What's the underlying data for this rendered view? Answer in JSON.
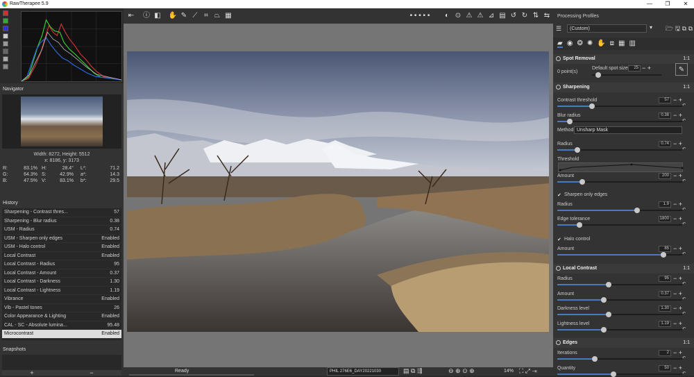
{
  "app": {
    "title": "RawTherapee 5.9"
  },
  "window": {
    "minimize": "—",
    "maximize": "❐",
    "close": "✕"
  },
  "left": {
    "navigator_title": "Navigator",
    "nav_size": "Width: 8272, Height: 5512",
    "nav_coords": "x: 8186, y: 3173",
    "color": {
      "r": "R:",
      "rv": "83.1%",
      "h": "H:",
      "hv": "28.4°",
      "l": "L*:",
      "lv": "71.2",
      "g": "G:",
      "gv": "64.3%",
      "s": "S:",
      "sv": "42.9%",
      "a": "a*:",
      "av": "14.3",
      "b": "B:",
      "bv": "47.5%",
      "v": "V:",
      "vv": "83.1%",
      "bs": "b*:",
      "bsv": "29.5"
    },
    "history_title": "History",
    "history": [
      {
        "n": "Sharpening - Contrast thres...",
        "v": "57"
      },
      {
        "n": "Sharpening - Blur radius",
        "v": "0.38"
      },
      {
        "n": "USM - Radius",
        "v": "0.74"
      },
      {
        "n": "USM - Sharpen only edges",
        "v": "Enabled"
      },
      {
        "n": "USM - Halo control",
        "v": "Enabled"
      },
      {
        "n": "Local Contrast",
        "v": "Enabled"
      },
      {
        "n": "Local Contrast - Radius",
        "v": "95"
      },
      {
        "n": "Local Contrast - Amount",
        "v": "0.37"
      },
      {
        "n": "Local Contrast - Darkness",
        "v": "1.30"
      },
      {
        "n": "Local Contrast - Lightness",
        "v": "1.19"
      },
      {
        "n": "Vibrance",
        "v": "Enabled"
      },
      {
        "n": "Vib - Pastel tones",
        "v": "26"
      },
      {
        "n": "Color Appearance & Lighting",
        "v": "Enabled"
      },
      {
        "n": "CAL - SC - Absolute lumina...",
        "v": "95.48"
      },
      {
        "n": "Microcontrast",
        "v": "Enabled"
      }
    ],
    "snapshots_title": "Snapshots",
    "snap_add": "+",
    "snap_remove": "−"
  },
  "center": {
    "status": "Ready",
    "profile_file": "PHIL 276E6_DAY20221030",
    "zoom": "14%"
  },
  "right": {
    "processing_profiles": "Processing Profiles",
    "profile_value": "(Custom)",
    "spot": {
      "title": "Spot Removal",
      "ver": "1:1",
      "points": "0 point(s)",
      "size_label": "Default spot size",
      "size": "25"
    },
    "sharp": {
      "title": "Sharpening",
      "ver": "1:1",
      "contrast_label": "Contrast threshold",
      "contrast": "57",
      "blur_label": "Blur radius",
      "blur": "0.38",
      "method_label": "Method:",
      "method": "Unsharp Mask",
      "radius_label": "Radius",
      "radius": "0.74",
      "threshold_label": "Threshold",
      "amount_label": "Amount",
      "amount": "200",
      "edges_label": "Sharpen only edges",
      "radius2_label": "Radius",
      "radius2": "1.9",
      "edgetol_label": "Edge tolerance",
      "edgetol": "1800",
      "halo_label": "Halo control",
      "halo_amount_label": "Amount",
      "halo_amount": "85"
    },
    "lc": {
      "title": "Local Contrast",
      "ver": "1:1",
      "radius_label": "Radius",
      "radius": "95",
      "amount_label": "Amount",
      "amount": "0.37",
      "dark_label": "Darkness level",
      "dark": "1.30",
      "light_label": "Lightness level",
      "light": "1.19"
    },
    "edges": {
      "title": "Edges",
      "ver": "1:1",
      "iter_label": "Iterations",
      "iter": "2",
      "qty_label": "Quantity",
      "qty": "50"
    }
  },
  "colors": {
    "accent": "#4a7abf",
    "panel": "#333333",
    "viewer": "#757575"
  },
  "icons": [
    "hand-icon",
    "color-picker-icon",
    "crop-icon",
    "straighten-icon",
    "perspective-icon",
    "histogram-icon",
    "rotate-left-icon",
    "rotate-right-icon",
    "flip-icon",
    "zoom-in-icon",
    "zoom-out-icon",
    "zoom-fit-icon"
  ]
}
